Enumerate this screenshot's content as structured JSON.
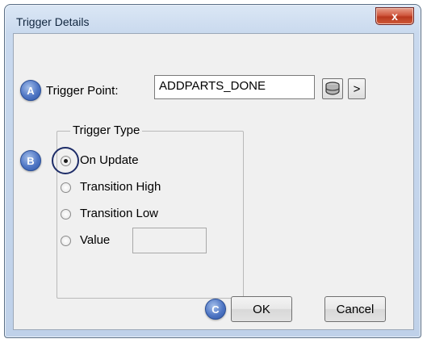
{
  "window": {
    "title": "Trigger Details",
    "close_glyph": "x"
  },
  "callouts": {
    "a": "A",
    "b": "B",
    "c": "C"
  },
  "trigger_point": {
    "label": "Trigger Point:",
    "value": "ADDPARTS_DONE",
    "browse_icon": "database-browse-icon",
    "more_glyph": ">"
  },
  "trigger_type": {
    "legend": "Trigger Type",
    "options": [
      {
        "label": "On Update",
        "checked": true
      },
      {
        "label": "Transition High",
        "checked": false
      },
      {
        "label": "Transition Low",
        "checked": false
      },
      {
        "label": "Value",
        "checked": false
      }
    ],
    "value_field": ""
  },
  "buttons": {
    "ok": "OK",
    "cancel": "Cancel"
  }
}
